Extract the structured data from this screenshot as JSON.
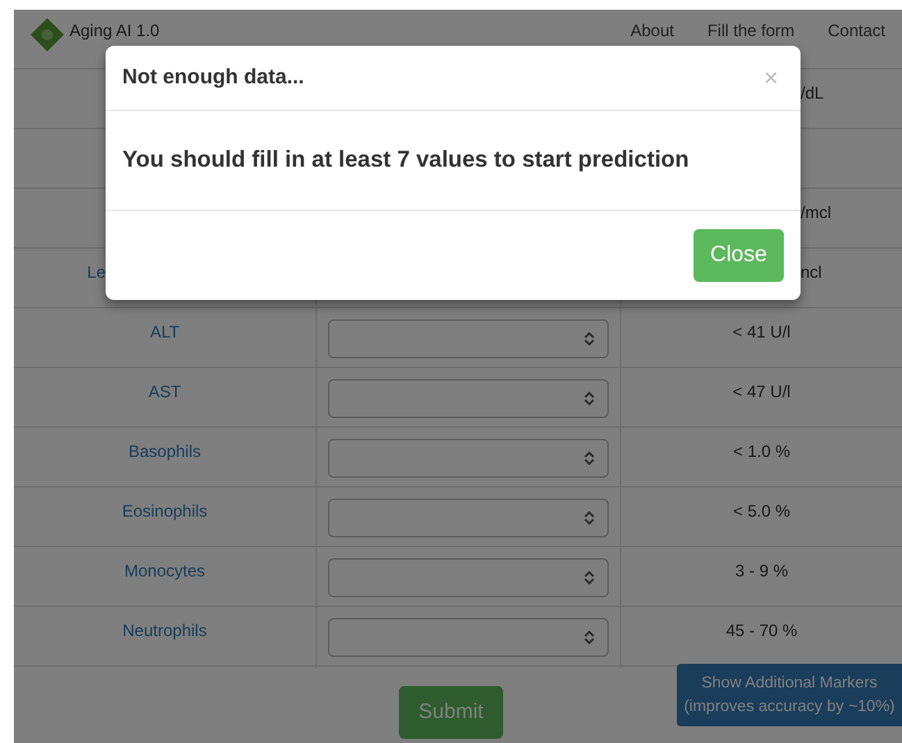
{
  "navbar": {
    "brand": "Aging AI 1.0",
    "links": [
      "About",
      "Fill the form",
      "Contact"
    ]
  },
  "table": {
    "rows": [
      {
        "kind": "covered",
        "reference": "/dL"
      },
      {
        "kind": "covered"
      },
      {
        "kind": "covered",
        "reference": "/mcl"
      },
      {
        "kind": "covered",
        "label": "Le",
        "reference": "ncl"
      },
      {
        "kind": "field",
        "label": "ALT",
        "reference": "< 41 U/l"
      },
      {
        "kind": "field",
        "label": "AST",
        "reference": "< 47 U/l"
      },
      {
        "kind": "field",
        "label": "Basophils",
        "reference": "< 1.0 %"
      },
      {
        "kind": "field",
        "label": "Eosinophils",
        "reference": "< 5.0 %"
      },
      {
        "kind": "field",
        "label": "Monocytes",
        "reference": "3 - 9 %"
      },
      {
        "kind": "field",
        "label": "Neutrophils",
        "reference": "45 - 70 %"
      }
    ]
  },
  "submit_button": "Submit",
  "additional_button": [
    "Show Additional Markers",
    "(improves accuracy by ~10%)"
  ],
  "modal": {
    "title": "Not enough data...",
    "dismiss": "×",
    "message": "You should fill in at least 7 values to start prediction",
    "close_button": "Close"
  }
}
